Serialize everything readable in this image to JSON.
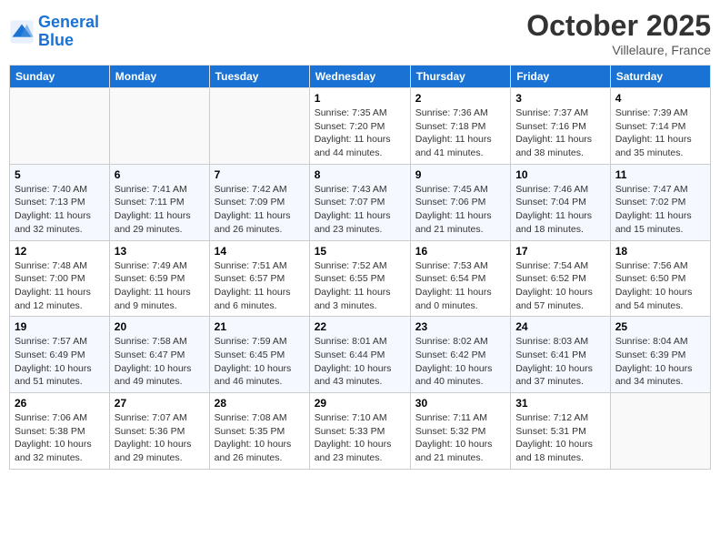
{
  "header": {
    "logo_line1": "General",
    "logo_line2": "Blue",
    "month": "October 2025",
    "location": "Villelaure, France"
  },
  "weekdays": [
    "Sunday",
    "Monday",
    "Tuesday",
    "Wednesday",
    "Thursday",
    "Friday",
    "Saturday"
  ],
  "weeks": [
    [
      {
        "day": "",
        "info": ""
      },
      {
        "day": "",
        "info": ""
      },
      {
        "day": "",
        "info": ""
      },
      {
        "day": "1",
        "info": "Sunrise: 7:35 AM\nSunset: 7:20 PM\nDaylight: 11 hours and 44 minutes."
      },
      {
        "day": "2",
        "info": "Sunrise: 7:36 AM\nSunset: 7:18 PM\nDaylight: 11 hours and 41 minutes."
      },
      {
        "day": "3",
        "info": "Sunrise: 7:37 AM\nSunset: 7:16 PM\nDaylight: 11 hours and 38 minutes."
      },
      {
        "day": "4",
        "info": "Sunrise: 7:39 AM\nSunset: 7:14 PM\nDaylight: 11 hours and 35 minutes."
      }
    ],
    [
      {
        "day": "5",
        "info": "Sunrise: 7:40 AM\nSunset: 7:13 PM\nDaylight: 11 hours and 32 minutes."
      },
      {
        "day": "6",
        "info": "Sunrise: 7:41 AM\nSunset: 7:11 PM\nDaylight: 11 hours and 29 minutes."
      },
      {
        "day": "7",
        "info": "Sunrise: 7:42 AM\nSunset: 7:09 PM\nDaylight: 11 hours and 26 minutes."
      },
      {
        "day": "8",
        "info": "Sunrise: 7:43 AM\nSunset: 7:07 PM\nDaylight: 11 hours and 23 minutes."
      },
      {
        "day": "9",
        "info": "Sunrise: 7:45 AM\nSunset: 7:06 PM\nDaylight: 11 hours and 21 minutes."
      },
      {
        "day": "10",
        "info": "Sunrise: 7:46 AM\nSunset: 7:04 PM\nDaylight: 11 hours and 18 minutes."
      },
      {
        "day": "11",
        "info": "Sunrise: 7:47 AM\nSunset: 7:02 PM\nDaylight: 11 hours and 15 minutes."
      }
    ],
    [
      {
        "day": "12",
        "info": "Sunrise: 7:48 AM\nSunset: 7:00 PM\nDaylight: 11 hours and 12 minutes."
      },
      {
        "day": "13",
        "info": "Sunrise: 7:49 AM\nSunset: 6:59 PM\nDaylight: 11 hours and 9 minutes."
      },
      {
        "day": "14",
        "info": "Sunrise: 7:51 AM\nSunset: 6:57 PM\nDaylight: 11 hours and 6 minutes."
      },
      {
        "day": "15",
        "info": "Sunrise: 7:52 AM\nSunset: 6:55 PM\nDaylight: 11 hours and 3 minutes."
      },
      {
        "day": "16",
        "info": "Sunrise: 7:53 AM\nSunset: 6:54 PM\nDaylight: 11 hours and 0 minutes."
      },
      {
        "day": "17",
        "info": "Sunrise: 7:54 AM\nSunset: 6:52 PM\nDaylight: 10 hours and 57 minutes."
      },
      {
        "day": "18",
        "info": "Sunrise: 7:56 AM\nSunset: 6:50 PM\nDaylight: 10 hours and 54 minutes."
      }
    ],
    [
      {
        "day": "19",
        "info": "Sunrise: 7:57 AM\nSunset: 6:49 PM\nDaylight: 10 hours and 51 minutes."
      },
      {
        "day": "20",
        "info": "Sunrise: 7:58 AM\nSunset: 6:47 PM\nDaylight: 10 hours and 49 minutes."
      },
      {
        "day": "21",
        "info": "Sunrise: 7:59 AM\nSunset: 6:45 PM\nDaylight: 10 hours and 46 minutes."
      },
      {
        "day": "22",
        "info": "Sunrise: 8:01 AM\nSunset: 6:44 PM\nDaylight: 10 hours and 43 minutes."
      },
      {
        "day": "23",
        "info": "Sunrise: 8:02 AM\nSunset: 6:42 PM\nDaylight: 10 hours and 40 minutes."
      },
      {
        "day": "24",
        "info": "Sunrise: 8:03 AM\nSunset: 6:41 PM\nDaylight: 10 hours and 37 minutes."
      },
      {
        "day": "25",
        "info": "Sunrise: 8:04 AM\nSunset: 6:39 PM\nDaylight: 10 hours and 34 minutes."
      }
    ],
    [
      {
        "day": "26",
        "info": "Sunrise: 7:06 AM\nSunset: 5:38 PM\nDaylight: 10 hours and 32 minutes."
      },
      {
        "day": "27",
        "info": "Sunrise: 7:07 AM\nSunset: 5:36 PM\nDaylight: 10 hours and 29 minutes."
      },
      {
        "day": "28",
        "info": "Sunrise: 7:08 AM\nSunset: 5:35 PM\nDaylight: 10 hours and 26 minutes."
      },
      {
        "day": "29",
        "info": "Sunrise: 7:10 AM\nSunset: 5:33 PM\nDaylight: 10 hours and 23 minutes."
      },
      {
        "day": "30",
        "info": "Sunrise: 7:11 AM\nSunset: 5:32 PM\nDaylight: 10 hours and 21 minutes."
      },
      {
        "day": "31",
        "info": "Sunrise: 7:12 AM\nSunset: 5:31 PM\nDaylight: 10 hours and 18 minutes."
      },
      {
        "day": "",
        "info": ""
      }
    ]
  ]
}
